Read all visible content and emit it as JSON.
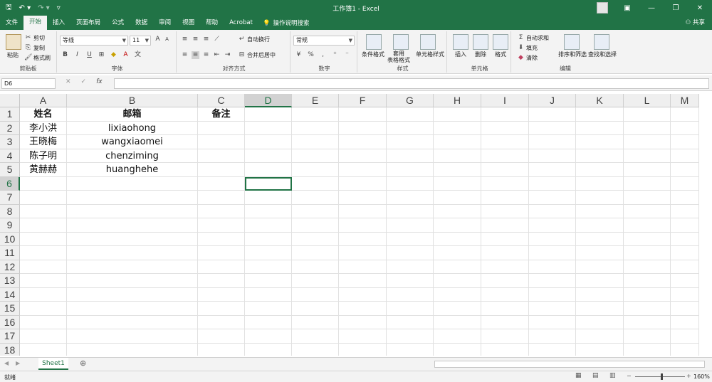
{
  "titlebar": {
    "title": "工作簿1 - Excel"
  },
  "tabs": [
    "文件",
    "开始",
    "插入",
    "页面布局",
    "公式",
    "数据",
    "审阅",
    "视图",
    "帮助",
    "Acrobat"
  ],
  "active_tab": "开始",
  "tell_me": "操作说明搜索",
  "share": "共享",
  "ribbon": {
    "clipboard": {
      "paste": "粘贴",
      "cut": "剪切",
      "copy": "复制",
      "format_painter": "格式刷",
      "label": "剪贴板"
    },
    "font": {
      "name": "等线",
      "size": "11",
      "label": "字体"
    },
    "alignment": {
      "wrap": "自动换行",
      "merge": "合并后居中",
      "label": "对齐方式"
    },
    "number": {
      "format": "常规",
      "label": "数字"
    },
    "styles": {
      "conditional": "条件格式",
      "table": "套用\n表格格式",
      "cell_styles": "单元格样式",
      "label": "样式"
    },
    "cells": {
      "insert": "插入",
      "delete": "删除",
      "format": "格式",
      "label": "单元格"
    },
    "editing": {
      "autosum": "自动求和",
      "fill": "填充",
      "clear": "清除",
      "sort": "排序和筛选",
      "find": "查找和选择",
      "label": "编辑"
    }
  },
  "formula_bar": {
    "name_box": "D6",
    "fx": "fx",
    "value": ""
  },
  "columns": [
    "A",
    "B",
    "C",
    "D",
    "E",
    "F",
    "G",
    "H",
    "I",
    "J",
    "K",
    "L",
    "M"
  ],
  "selected_column": "D",
  "rows": [
    "1",
    "2",
    "3",
    "4",
    "5",
    "6",
    "7",
    "8",
    "9",
    "10",
    "11",
    "12",
    "13",
    "14",
    "15",
    "16",
    "17",
    "18"
  ],
  "selected_row": "6",
  "cells": {
    "A1": "姓名",
    "B1": "邮箱",
    "C1": "备注",
    "A2": "李小洪",
    "B2": "lixiaohong",
    "A3": "王晓梅",
    "B3": "wangxiaomei",
    "A4": "陈子明",
    "B4": "chenziming",
    "A5": "黄赫赫",
    "B5": "huanghehe"
  },
  "sheets": [
    "Sheet1"
  ],
  "status": {
    "ready": "就绪",
    "zoom": "160%"
  },
  "colors": {
    "excel_green": "#217346"
  }
}
